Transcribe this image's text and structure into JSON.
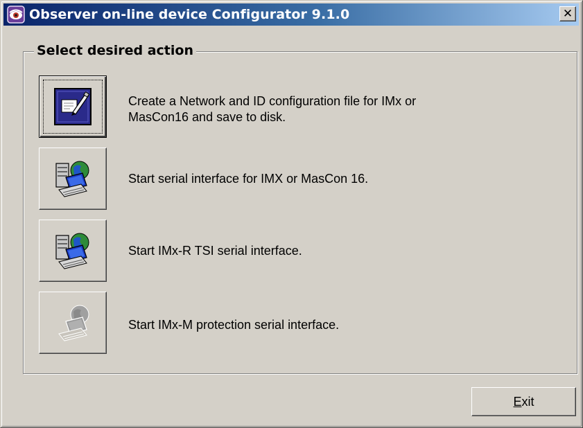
{
  "window": {
    "title": "Observer on-line device Configurator 9.1.0",
    "close_glyph": "✕",
    "title_icon": "observer-eye-icon"
  },
  "group": {
    "legend": "Select desired action"
  },
  "actions": [
    {
      "label_line1": "Create a Network and ID configuration file for IMx or",
      "label_line2": "MasCon16 and save to disk.",
      "icon": "edit-document-icon",
      "enabled": true,
      "focused": true
    },
    {
      "label_line1": "Start serial interface for IMX or MasCon 16.",
      "icon": "computer-network-icon",
      "enabled": true,
      "focused": false
    },
    {
      "label_line1": "Start IMx-R TSI serial interface.",
      "icon": "computer-network-icon",
      "enabled": true,
      "focused": false
    },
    {
      "label_line1": "Start IMx-M protection serial interface.",
      "icon": "computer-network-icon",
      "enabled": false,
      "focused": false
    }
  ],
  "footer": {
    "exit_mnemonic": "E",
    "exit_rest": "xit"
  },
  "colors": {
    "face": "#d4d0c8",
    "titlebar_start": "#0a246a",
    "titlebar_end": "#a6caf0"
  }
}
